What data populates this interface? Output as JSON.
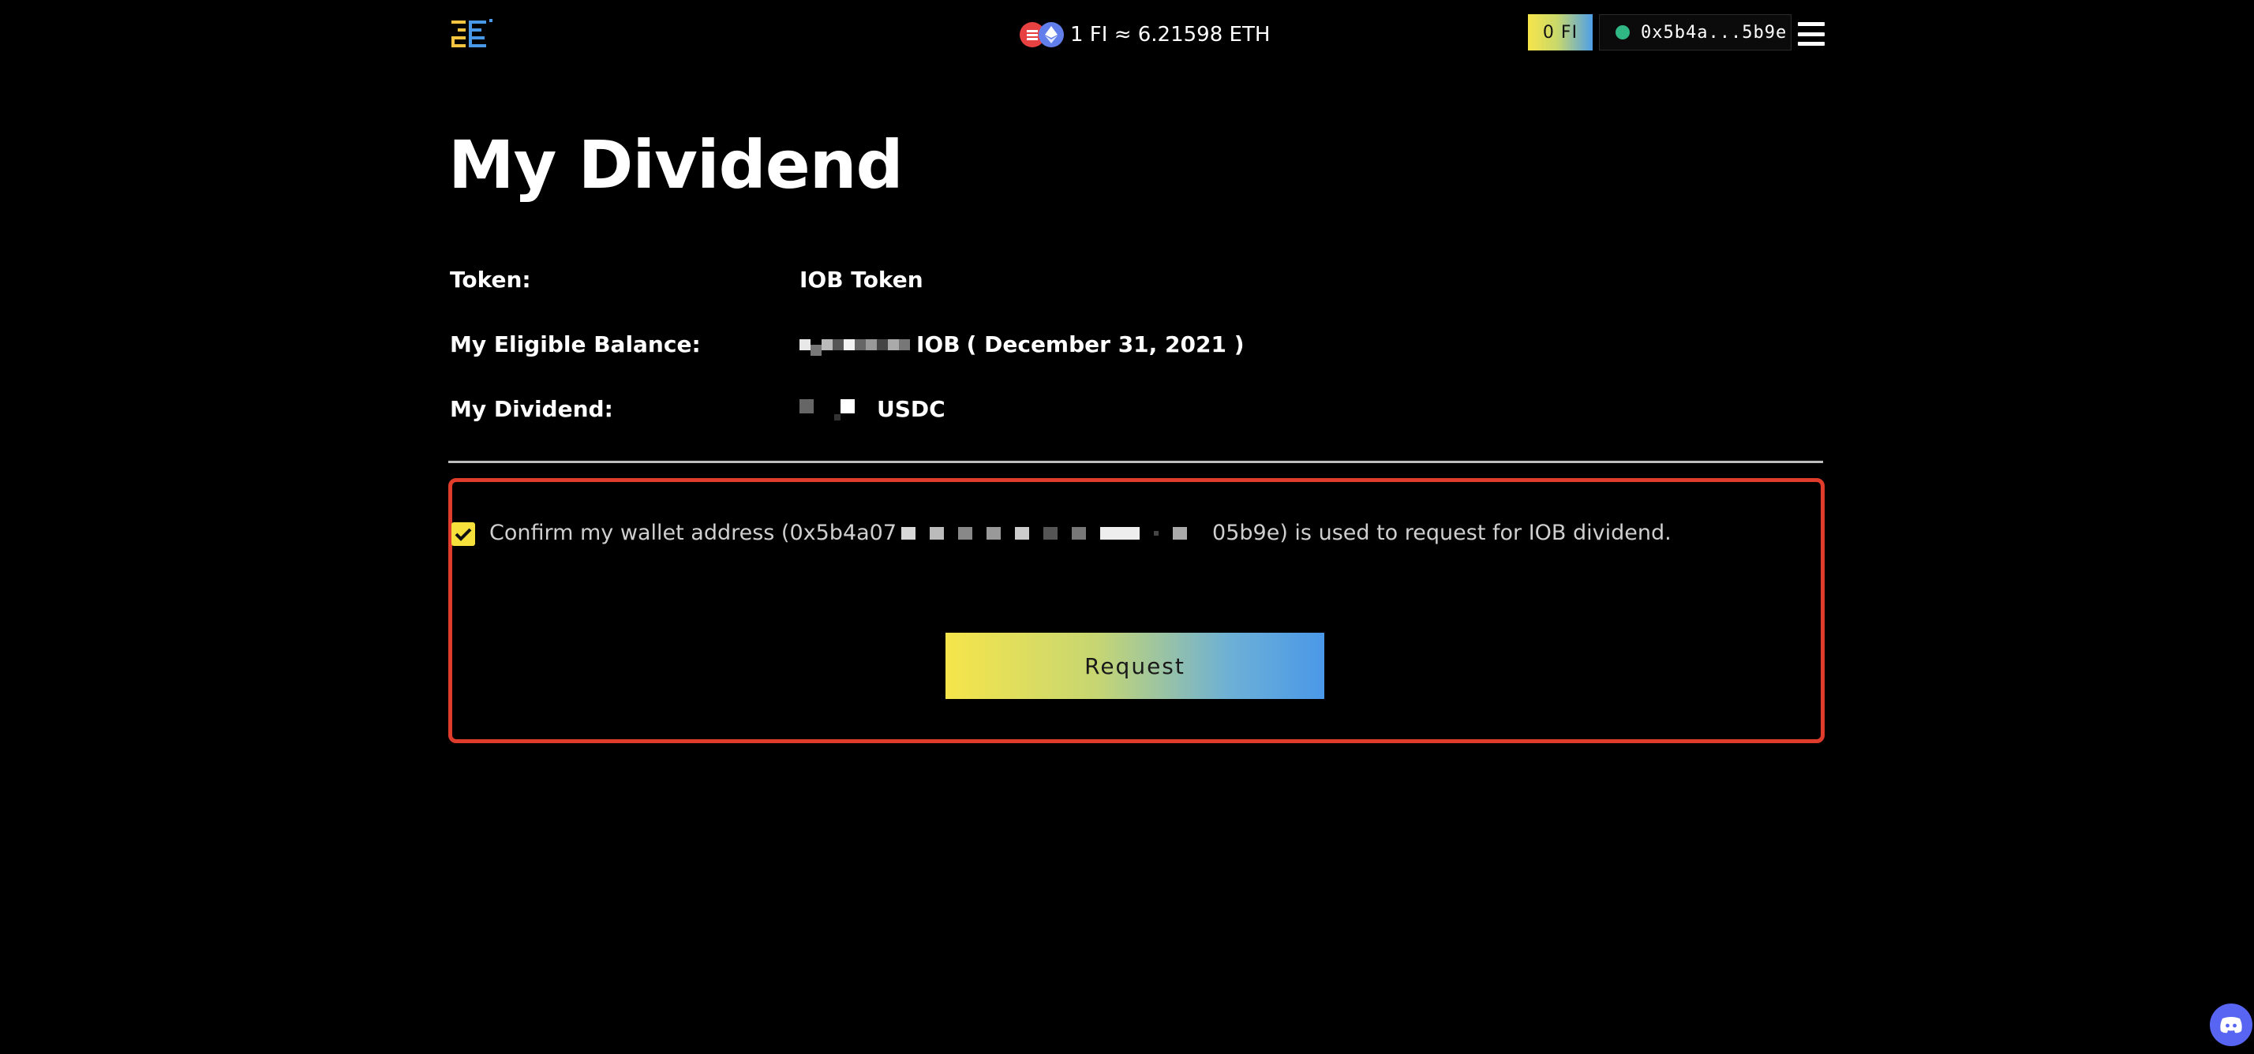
{
  "header": {
    "price_text": "1 FI ≈ 6.21598 ETH",
    "fi_balance": "0 FI",
    "wallet_short": "0x5b4a...5b9e"
  },
  "page": {
    "title": "My Dividend"
  },
  "info": {
    "token_label": "Token:",
    "token_value": "IOB Token",
    "balance_label": "My Eligible Balance:",
    "balance_unit": "IOB",
    "balance_date": "( December 31, 2021 )",
    "dividend_label": "My Dividend:",
    "dividend_unit": "USDC"
  },
  "confirm": {
    "checked": true,
    "text_prefix": "Confirm my wallet address (0x5b4a07",
    "text_suffix": "05b9e) is used to request for IOB dividend."
  },
  "actions": {
    "request_label": "Request"
  },
  "colors": {
    "background": "#000000",
    "accent_yellow": "#f5e03c",
    "accent_blue": "#4a98e8",
    "highlight_border": "#e03c2b",
    "status_green": "#2fb784"
  }
}
